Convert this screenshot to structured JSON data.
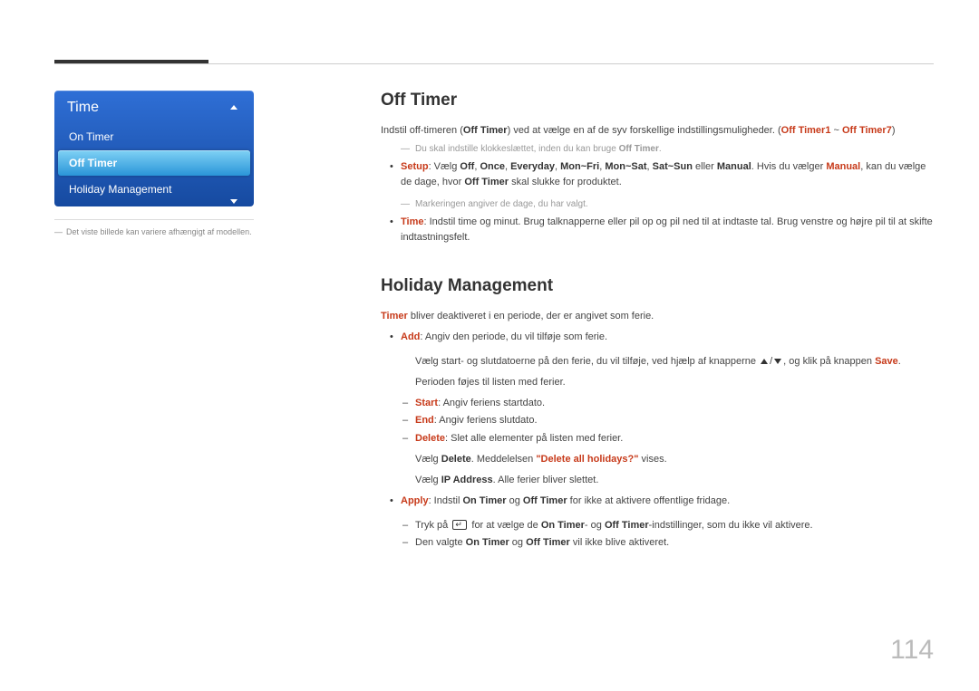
{
  "menu": {
    "title": "Time",
    "items": [
      "On Timer",
      "Off Timer",
      "Holiday Management"
    ],
    "selected_index": 1
  },
  "left_caption": "Det viste billede kan variere afhængigt af modellen.",
  "section1": {
    "heading": "Off Timer",
    "intro": {
      "prefix": "Indstil off-timeren (",
      "b1": "Off Timer",
      "mid": ") ved at vælge en af de syv forskellige indstillingsmuligheder. (",
      "b2": "Off Timer1",
      "tilde": " ~ ",
      "b3": "Off Timer7",
      "suffix": ")"
    },
    "note1": {
      "text": "Du skal indstille klokkeslættet, inden du kan bruge ",
      "b": "Off Timer",
      "suffix": "."
    },
    "setup_item": {
      "label": "Setup",
      "text1": ": Vælg ",
      "o1": "Off",
      "o2": "Once",
      "o3": "Everyday",
      "o4": "Mon~Fri",
      "o5": "Mon~Sat",
      "o6": "Sat~Sun",
      "text2": " eller ",
      "o7": "Manual",
      "text3": ". Hvis du vælger ",
      "o7b": "Manual",
      "text4": ", kan du vælge de dage, hvor ",
      "b": "Off Timer",
      "text5": " skal slukke for produktet."
    },
    "setup_subnote": "Markeringen angiver de dage, du har valgt.",
    "time_item": {
      "label": "Time",
      "text": ": Indstil time og minut. Brug talknapperne eller pil op og pil ned til at indtaste tal. Brug venstre og højre pil til at skifte indtastningsfelt."
    }
  },
  "section2": {
    "heading": "Holiday Management",
    "intro": {
      "b": "Timer",
      "text": " bliver deaktiveret i en periode, der er angivet som ferie."
    },
    "add_item": {
      "label": "Add",
      "text": ": Angiv den periode, du vil tilføje som ferie."
    },
    "add_line2_a": "Vælg start- og slutdatoerne på den ferie, du vil tilføje, ved hjælp af knapperne ",
    "add_line2_b": ", og klik på knappen ",
    "add_line2_save": "Save",
    "add_line2_c": ".",
    "add_line3": "Perioden føjes til listen med ferier.",
    "start": {
      "label": "Start",
      "text": ": Angiv feriens startdato."
    },
    "end": {
      "label": "End",
      "text": ": Angiv feriens slutdato."
    },
    "delete": {
      "label": "Delete",
      "text1": ": Slet alle elementer på listen med ferier.",
      "text2a": "Vælg ",
      "b1": "Delete",
      "text2b": ". Meddelelsen ",
      "quote": "\"Delete all holidays?\"",
      "text2c": " vises.",
      "text3a": "Vælg ",
      "b2": "IP Address",
      "text3b": ". Alle ferier bliver slettet."
    },
    "apply_item": {
      "label": "Apply",
      "text1": ": Indstil ",
      "b1": "On Timer",
      "text2": " og ",
      "b2": "Off Timer",
      "text3": " for ikke at aktivere offentlige fridage."
    },
    "apply_sub1": {
      "a": "Tryk på ",
      "b": " for at vælge de ",
      "b1": "On Timer",
      "c": "- og ",
      "b2": "Off Timer",
      "d": "-indstillinger, som du ikke vil aktivere."
    },
    "apply_sub2": {
      "a": "Den valgte ",
      "b1": "On Timer",
      "b": " og ",
      "b2": "Off Timer",
      "c": " vil ikke blive aktiveret."
    }
  },
  "page_number": "114"
}
